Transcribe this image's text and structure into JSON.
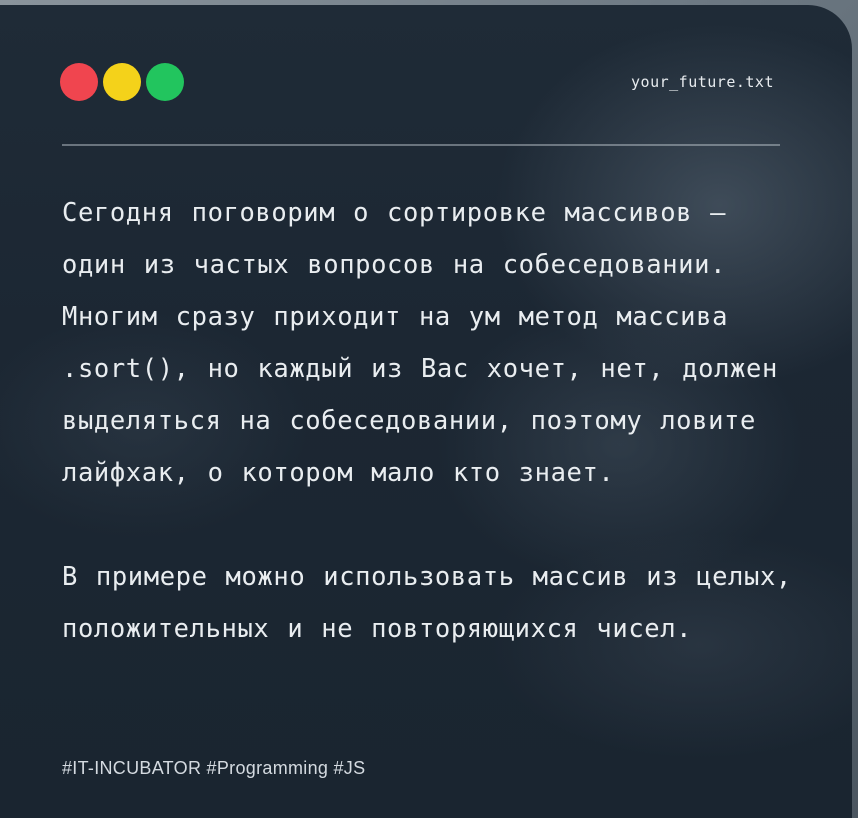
{
  "window": {
    "filename": "your_future.txt",
    "traffic_lights": [
      {
        "name": "close",
        "color": "#f0454f"
      },
      {
        "name": "minimize",
        "color": "#f4d21a"
      },
      {
        "name": "maximize",
        "color": "#22c55e"
      }
    ]
  },
  "content": {
    "paragraph_1": "Сегодня поговорим о сортировке массивов — один из частых вопросов на собеседовании. Многим сразу приходит на ум метод массива .sort(), но каждый из Вас хочет, нет, должен выделяться на собеседовании, поэтому ловите лайфхак, о котором мало кто знает.",
    "paragraph_2": "В примере можно использовать массив из целых, положительных и не повторяющихся чисел."
  },
  "footer": {
    "hashtags": "#IT-INCUBATOR #Programming #JS"
  }
}
